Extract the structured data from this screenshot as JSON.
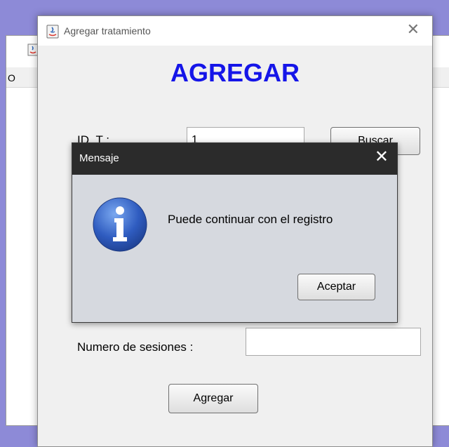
{
  "background_window": {
    "menu_label": "O"
  },
  "dialog": {
    "title": "Agregar tratamiento",
    "close_glyph": "✕",
    "heading": "AGREGAR",
    "fields": {
      "id_label": "ID_T :",
      "id_value": "1",
      "sessions_label": "Numero de sesiones :",
      "sessions_value": ""
    },
    "buttons": {
      "search": "Buscar",
      "add": "Agregar"
    }
  },
  "message": {
    "title": "Mensaje",
    "close_glyph": "✕",
    "text": "Puede continuar con el registro",
    "ok_button": "Aceptar",
    "icon": "info-icon"
  },
  "colors": {
    "desktop": "#8d8ad7",
    "heading": "#1515e8",
    "message_titlebar": "#2b2b2b",
    "message_body": "#d6d9df",
    "info_icon": "#2f5cc0"
  }
}
